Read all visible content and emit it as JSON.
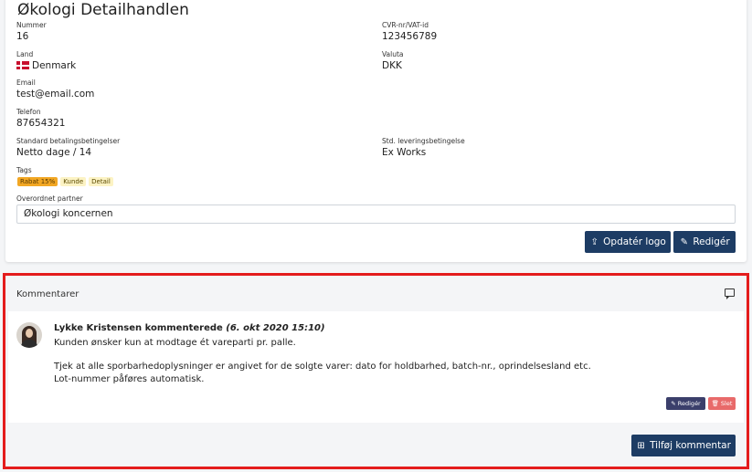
{
  "partner": {
    "title": "Økologi Detailhandlen",
    "fields": {
      "nummer": {
        "label": "Nummer",
        "value": "16"
      },
      "cvr": {
        "label": "CVR-nr/VAT-id",
        "value": "123456789"
      },
      "land": {
        "label": "Land",
        "value": "Denmark"
      },
      "valuta": {
        "label": "Valuta",
        "value": "DKK"
      },
      "email": {
        "label": "Email",
        "value": "test@email.com"
      },
      "telefon": {
        "label": "Telefon",
        "value": "87654321"
      },
      "betaling": {
        "label": "Standard betalingsbetingelser",
        "value": "Netto dage / 14"
      },
      "levering": {
        "label": "Std. leveringsbetingelse",
        "value": "Ex Works"
      },
      "overordnet": {
        "label": "Overordnet partner",
        "value": "Økologi koncernen"
      }
    },
    "tags_label": "Tags",
    "tags": [
      "Rabat 15%",
      "Kunde",
      "Detail"
    ],
    "buttons": {
      "update_logo": "Opdatér logo",
      "edit": "Redigér"
    }
  },
  "comments": {
    "header": "Kommentarer",
    "items": [
      {
        "author": "Lykke Kristensen kommenterede",
        "date": "(6. okt 2020 15:10)",
        "lines": [
          "Kunden ønsker kun at modtage ét vareparti pr. palle.",
          "Tjek at alle sporbarhedoplysninger er angivet for de solgte varer: dato for holdbarhed, batch-nr., oprindelsesland etc.",
          "Lot-nummer påføres automatisk."
        ],
        "edit_label": "Redigér",
        "delete_label": "Slet"
      }
    ],
    "add_label": "Tilføj kommentar"
  },
  "colors": {
    "primary": "#1d3c64",
    "highlight_frame": "#e41c1c",
    "tag_primary": "#f2a724",
    "tag_secondary": "#fcf3c4",
    "danger": "#e86a6a"
  },
  "icons": {
    "land": "denmark-flag-icon",
    "update_logo": "upload-icon",
    "edit": "edit-icon",
    "comments": "chat-icon",
    "delete": "trash-icon",
    "add": "plus-square-icon"
  }
}
